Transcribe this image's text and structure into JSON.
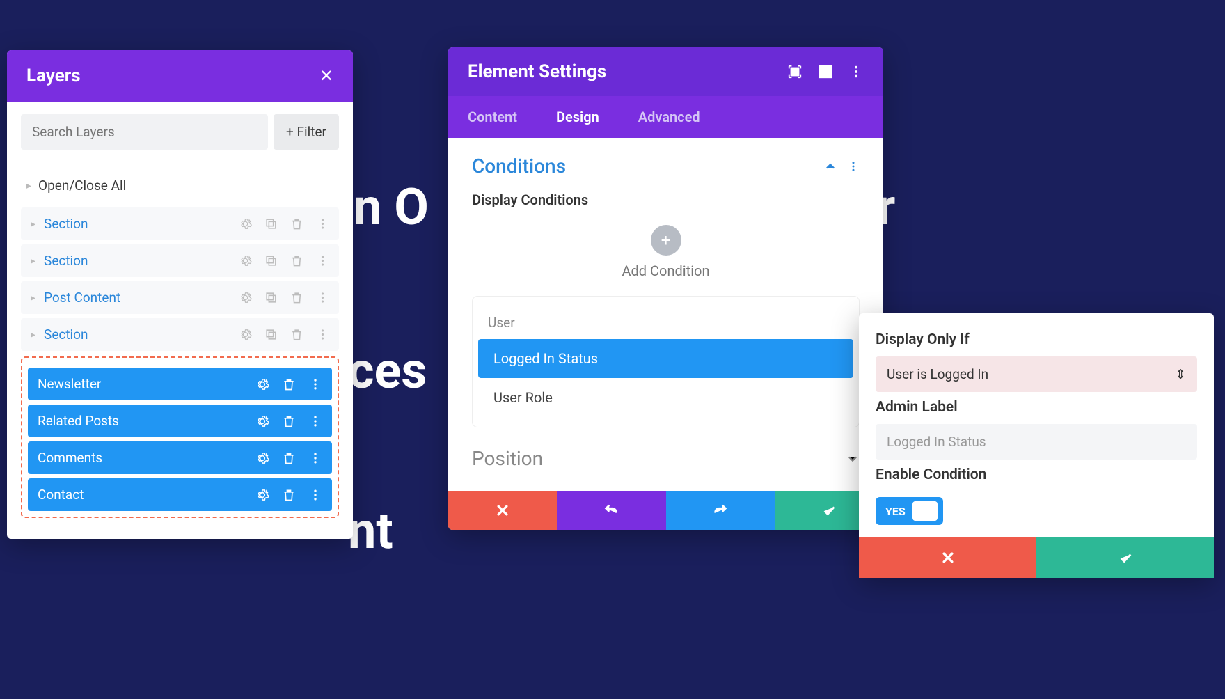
{
  "bg": {
    "t1": "n O",
    "t1b": "r",
    "t2": "ces",
    "t3": "nt"
  },
  "layers": {
    "title": "Layers",
    "search_placeholder": "Search Layers",
    "filter_label": "+  Filter",
    "open_close": "Open/Close All",
    "sections": [
      "Section",
      "Section",
      "Post Content",
      "Section"
    ],
    "selected": [
      "Newsletter",
      "Related Posts",
      "Comments",
      "Contact"
    ]
  },
  "settings": {
    "title": "Element Settings",
    "tabs": {
      "content": "Content",
      "design": "Design",
      "advanced": "Advanced"
    },
    "conditions_title": "Conditions",
    "display_conditions": "Display Conditions",
    "add_condition": "Add Condition",
    "cond_category": "User",
    "cond_items": {
      "logged_in": "Logged In Status",
      "user_role": "User Role"
    },
    "position_title": "Position"
  },
  "detail": {
    "display_only_if": "Display Only If",
    "dropdown_value": "User is Logged In",
    "admin_label": "Admin Label",
    "admin_value": "Logged In Status",
    "enable_condition": "Enable Condition",
    "toggle_yes": "YES"
  }
}
